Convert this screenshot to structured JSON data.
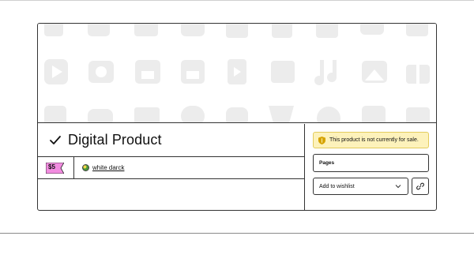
{
  "product": {
    "title": "Digital Product",
    "price": "$5",
    "creator_name": "white darck"
  },
  "sidebar": {
    "notice": "This product is not currently for sale.",
    "pages_label": "Pages",
    "wishlist_label": "Add to wishlist"
  },
  "colors": {
    "notice_background": "#fdf2bb",
    "price_tag": "#f28ce0",
    "cover_icons": "#ececec"
  },
  "icons": {
    "cover_pattern": [
      "phone-icon",
      "camera-icon",
      "store-icon",
      "file-icon",
      "music-icon",
      "image-icon",
      "gift-icon",
      "play-icon",
      "folder-icon",
      "gamepad-icon",
      "mail-icon",
      "cart-icon"
    ],
    "check": "check-icon",
    "notice": "shield-icon",
    "wishlist_chevron": "chevron-down-icon",
    "link": "link-icon"
  }
}
